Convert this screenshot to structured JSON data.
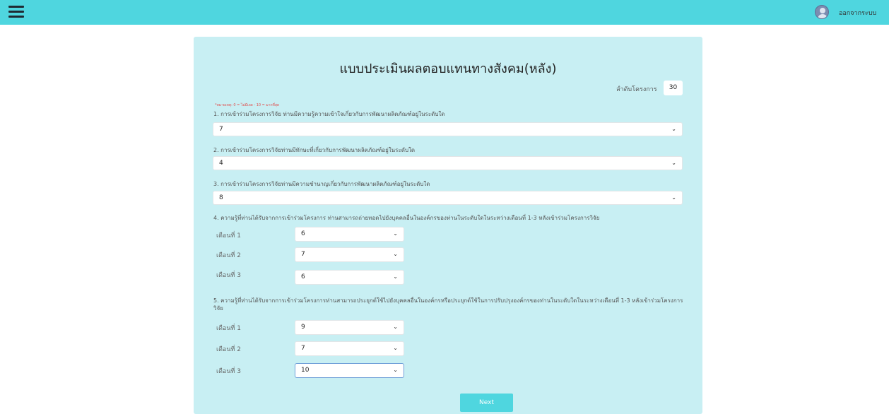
{
  "header": {
    "logout_label": "ออกจากระบบ"
  },
  "form": {
    "title": "แบบประเมินผลตอบแทนทางสังคม(หลัง)",
    "order_label": "ลำดับโครงการ",
    "order_value": "30",
    "note": "*หมายเหตุ: 0 = ไม่มีเลย - 10 = มากที่สุด",
    "q1": {
      "text": "1. การเข้าร่วมโครงการวิจัย ท่านมีความรู้ความเข้าใจเกี่ยวกับการพัฒนาผลิตภัณฑ์อยู่ในระดับใด",
      "value": "7"
    },
    "q2": {
      "text": "2. การเข้าร่วมโครงการวิจัยท่านมีทักษะที่เกี่ยวกับการพัฒนาผลิตภัณฑ์อยู่ในระดับใด",
      "value": "4"
    },
    "q3": {
      "text": "3. การเข้าร่วมโครงการวิจัยท่านมีความชำนาญเกี่ยวกับการพัฒนาผลิตภัณฑ์อยู่ในระดับใด",
      "value": "8"
    },
    "q4": {
      "text": "4. ความรู้ที่ท่านได้รับจากการเข้าร่วมโครงการ ท่านสามารถถ่ายทอดไปยังบุคคลอื่นในองค์กรของท่านในระดับใดในระหว่างเดือนที่ 1-3 หลังเข้าร่วมโครงการวิจัย",
      "months": [
        {
          "label": "เดือนที่ 1",
          "value": "6"
        },
        {
          "label": "เดือนที่ 2",
          "value": "7"
        },
        {
          "label": "เดือนที่ 3",
          "value": "6"
        }
      ]
    },
    "q5": {
      "text": "5. ความรู้ที่ท่านได้รับจากการเข้าร่วมโครงการท่านสามารถประยุกต์ใช้ไปยังบุคคลอื่นในองค์กรหรือประยุกต์ใช้ในการปรับปรุงองค์กรของท่านในระดับใดในระหว่างเดือนที่ 1-3 หลังเข้าร่วมโครงการวิจัย",
      "months": [
        {
          "label": "เดือนที่ 1",
          "value": "9"
        },
        {
          "label": "เดือนที่ 2",
          "value": "7"
        },
        {
          "label": "เดือนที่ 3",
          "value": "10"
        }
      ]
    },
    "next_label": "Next"
  },
  "icons": {
    "menu": "hamburger-icon",
    "avatar": "user-avatar-icon",
    "dropdown": "chevron-down-icon"
  },
  "colors": {
    "accent": "#4fd6df",
    "card": "#c8eff3",
    "note": "#e05050"
  }
}
